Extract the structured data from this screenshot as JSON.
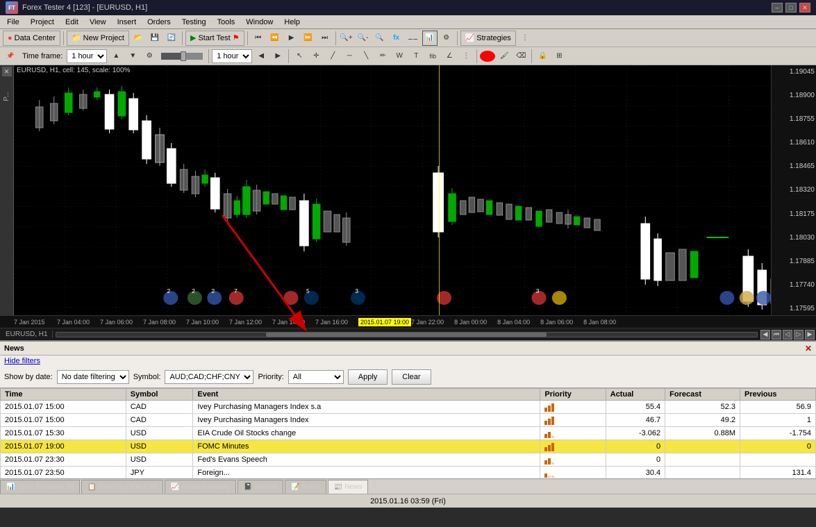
{
  "titleBar": {
    "title": "Forex Tester 4 [123] - [EURUSD, H1]",
    "controls": [
      "–",
      "□",
      "✕"
    ]
  },
  "menuBar": {
    "items": [
      "File",
      "Project",
      "Edit",
      "View",
      "Insert",
      "Orders",
      "Testing",
      "Tools",
      "Window",
      "Help"
    ]
  },
  "toolbar1": {
    "dataCenter": "Data Center",
    "newProject": "New Project",
    "startTest": "Start Test",
    "strategies": "Strategies"
  },
  "toolbar2": {
    "timeframeLabel": "Time frame:",
    "timeframe1": "1 hour",
    "timeframe2": "1 hour"
  },
  "chart": {
    "header": "EURUSD, H1, cell: 145, scale: 100%",
    "prices": [
      "1.19045",
      "1.18900",
      "1.18755",
      "1.18610",
      "1.18465",
      "1.18320",
      "1.18175",
      "1.18030",
      "1.17885",
      "1.17740",
      "1.17595"
    ],
    "times": [
      "7 Jan 2015",
      "7 Jan 04:00",
      "7 Jan 06:00",
      "7 Jan 08:00",
      "7 Jan 10:00",
      "7 Jan 12:00",
      "7 Jan 14:00",
      "7 Jan 16:00",
      "2015.01.07 19:00",
      "Jan 20:00",
      "7 Jan 22:00",
      "8 Jan 00:00",
      "8 Jan 02:00",
      "8 Jan 04:00",
      "8 Jan 06:00",
      "8 Jan 08:00"
    ],
    "cursorTime": "2015.01.07 19:00"
  },
  "scrollbar": {
    "symbol": "EURUSD, H1"
  },
  "newsPanel": {
    "title": "News",
    "closeLabel": "✕",
    "hideFilters": "Hide filters",
    "filterLabels": {
      "showByDate": "Show by date:",
      "symbol": "Symbol:",
      "priority": "Priority:"
    },
    "filterValues": {
      "date": "No date filtering",
      "symbol": "AUD;CAD;CHF;CNY",
      "priority": "All"
    },
    "applyBtn": "Apply",
    "clearBtn": "Clear",
    "tableHeaders": [
      "Time",
      "Symbol",
      "Event",
      "Priority",
      "Actual",
      "Forecast",
      "Previous"
    ],
    "rows": [
      {
        "time": "2015.01.07 15:00",
        "symbol": "CAD",
        "event": "Ivey Purchasing Managers Index s.a",
        "priority": 3,
        "actual": "55.4",
        "forecast": "52.3",
        "previous": "56.9",
        "highlighted": false
      },
      {
        "time": "2015.01.07 15:00",
        "symbol": "CAD",
        "event": "Ivey Purchasing Managers Index",
        "priority": 3,
        "actual": "46.7",
        "forecast": "49.2",
        "previous": "1",
        "highlighted": false
      },
      {
        "time": "2015.01.07 15:30",
        "symbol": "USD",
        "event": "EIA Crude Oil Stocks change",
        "priority": 2,
        "actual": "-3.062",
        "forecast": "0.88M",
        "previous": "-1.754",
        "highlighted": false
      },
      {
        "time": "2015.01.07 19:00",
        "symbol": "USD",
        "event": "FOMC Minutes",
        "priority": 3,
        "actual": "0",
        "forecast": "",
        "previous": "0",
        "highlighted": true
      },
      {
        "time": "2015.01.07 23:30",
        "symbol": "USD",
        "event": "Fed's Evans Speech",
        "priority": 2,
        "actual": "0",
        "forecast": "",
        "previous": "",
        "highlighted": false
      },
      {
        "time": "2015.01.07 23:50",
        "symbol": "JPY",
        "event": "Foreign...",
        "priority": 1,
        "actual": "30.4",
        "forecast": "",
        "previous": "131.4",
        "highlighted": false
      }
    ]
  },
  "bottomTabs": [
    {
      "label": "Open Positions [0]",
      "icon": "📊"
    },
    {
      "label": "Pending Orders [0]",
      "icon": "📋"
    },
    {
      "label": "Account History",
      "icon": "📈"
    },
    {
      "label": "Journal",
      "icon": "📓"
    },
    {
      "label": "Notes",
      "icon": "📝"
    },
    {
      "label": "News",
      "icon": "📰"
    }
  ],
  "statusBar": {
    "datetime": "2015.01.16 03:59 (Fri)"
  }
}
